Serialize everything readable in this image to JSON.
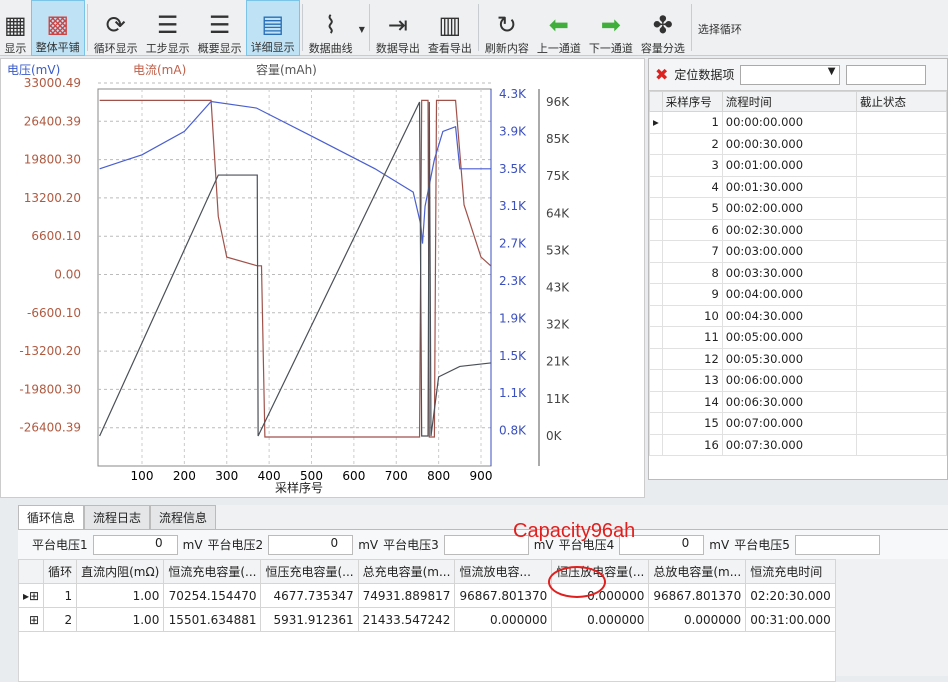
{
  "toolbar": {
    "items": [
      "显示",
      "整体平铺",
      "循环显示",
      "工步显示",
      "概要显示",
      "详细显示",
      "数据曲线",
      "数据导出",
      "查看导出",
      "刷新内容",
      "上一通道",
      "下一通道",
      "容量分选"
    ],
    "select_cycle": "选择循环"
  },
  "chart_data": {
    "type": "line",
    "legend": [
      "电压(mV)",
      "电流(mA)",
      "容量(mAh)"
    ],
    "xlabel": "采样序号",
    "x_ticks": [
      "100",
      "200",
      "300",
      "400",
      "500",
      "600",
      "700",
      "800",
      "900"
    ],
    "y_left_ticks": [
      "33000.49",
      "26400.39",
      "19800.30",
      "13200.20",
      "6600.10",
      "0.00",
      "-6600.10",
      "-13200.20",
      "-19800.30",
      "-26400.39"
    ],
    "y_blue_ticks": [
      "4.3K",
      "3.9K",
      "3.5K",
      "3.1K",
      "2.7K",
      "2.3K",
      "1.9K",
      "1.5K",
      "1.1K",
      "0.8K"
    ],
    "y_right_ticks": [
      "96K",
      "85K",
      "75K",
      "64K",
      "53K",
      "43K",
      "32K",
      "21K",
      "11K",
      "0K"
    ],
    "series": [
      {
        "name": "电流",
        "color": "#a0524a",
        "axis": "left",
        "points": [
          [
            0,
            30000
          ],
          [
            263,
            30000
          ],
          [
            280,
            10000
          ],
          [
            300,
            3000
          ],
          [
            372,
            1500
          ],
          [
            382,
            1500
          ],
          [
            390,
            -28000
          ],
          [
            755,
            -28000
          ],
          [
            760,
            30000
          ],
          [
            775,
            30000
          ],
          [
            778,
            -28000
          ],
          [
            790,
            -28000
          ],
          [
            795,
            30000
          ],
          [
            840,
            30000
          ],
          [
            860,
            12000
          ],
          [
            900,
            3000
          ],
          [
            923,
            1500
          ]
        ]
      },
      {
        "name": "电压",
        "color": "#4a5fd0",
        "axis": "blue",
        "points": [
          [
            0,
            3.5
          ],
          [
            100,
            3.65
          ],
          [
            200,
            3.9
          ],
          [
            263,
            4.22
          ],
          [
            370,
            4.15
          ],
          [
            500,
            3.85
          ],
          [
            650,
            3.5
          ],
          [
            740,
            3.25
          ],
          [
            758,
            2.9
          ],
          [
            762,
            2.7
          ],
          [
            768,
            3.1
          ],
          [
            790,
            3.6
          ],
          [
            810,
            3.9
          ],
          [
            840,
            3.95
          ],
          [
            850,
            3.5
          ],
          [
            923,
            3.5
          ]
        ]
      },
      {
        "name": "容量",
        "color": "#4a5058",
        "axis": "right",
        "points": [
          [
            0,
            0
          ],
          [
            280,
            75
          ],
          [
            372,
            75
          ],
          [
            374,
            0
          ],
          [
            755,
            96
          ],
          [
            760,
            0
          ],
          [
            775,
            0
          ],
          [
            778,
            96
          ],
          [
            782,
            0
          ],
          [
            800,
            17
          ],
          [
            850,
            20
          ],
          [
            923,
            21
          ]
        ]
      }
    ]
  },
  "right_panel": {
    "locate_label": "定位数据项",
    "columns": [
      "采样序号",
      "流程时间",
      "截止状态"
    ],
    "rows": [
      [
        "1",
        "00:00:00.000"
      ],
      [
        "2",
        "00:00:30.000"
      ],
      [
        "3",
        "00:01:00.000"
      ],
      [
        "4",
        "00:01:30.000"
      ],
      [
        "5",
        "00:02:00.000"
      ],
      [
        "6",
        "00:02:30.000"
      ],
      [
        "7",
        "00:03:00.000"
      ],
      [
        "8",
        "00:03:30.000"
      ],
      [
        "9",
        "00:04:00.000"
      ],
      [
        "10",
        "00:04:30.000"
      ],
      [
        "11",
        "00:05:00.000"
      ],
      [
        "12",
        "00:05:30.000"
      ],
      [
        "13",
        "00:06:00.000"
      ],
      [
        "14",
        "00:06:30.000"
      ],
      [
        "15",
        "00:07:00.000"
      ],
      [
        "16",
        "00:07:30.000"
      ]
    ]
  },
  "bottom": {
    "tabs": [
      "循环信息",
      "流程日志",
      "流程信息"
    ],
    "platforms": [
      {
        "label": "平台电压1",
        "value": "0"
      },
      {
        "label": "平台电压2",
        "value": "0"
      },
      {
        "label": "平台电压3",
        "value": ""
      },
      {
        "label": "平台电压4",
        "value": "0"
      },
      {
        "label": "平台电压5",
        "value": ""
      }
    ],
    "unit": "mV",
    "columns": [
      "循环",
      "直流内阻(mΩ)",
      "恒流充电容量(...",
      "恒压充电容量(...",
      "总充电容量(m...",
      "恒流放电容...",
      "恒压放电容量(...",
      "总放电容量(m...",
      "恒流充电时间"
    ],
    "rows": [
      [
        "1",
        "1.00",
        "70254.154470",
        "4677.735347",
        "74931.889817",
        "96867.801370",
        "0.000000",
        "96867.801370",
        "02:20:30.000"
      ],
      [
        "2",
        "1.00",
        "15501.634881",
        "5931.912361",
        "21433.547242",
        "0.000000",
        "0.000000",
        "0.000000",
        "00:31:00.000"
      ]
    ]
  },
  "annotation": "Capacity96ah"
}
